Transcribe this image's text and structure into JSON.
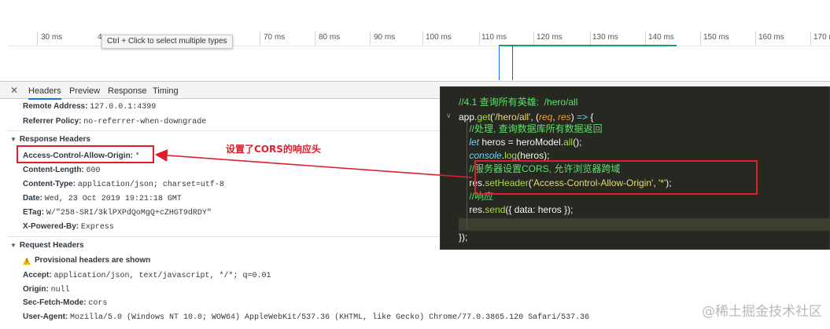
{
  "timeline": {
    "ticks": [
      "30 ms",
      "4",
      "70 ms",
      "80 ms",
      "90 ms",
      "100 ms",
      "110 ms",
      "120 ms",
      "130 ms",
      "140 ms",
      "150 ms",
      "160 ms",
      "170 m"
    ],
    "tooltip": "Ctrl + Click to select multiple types"
  },
  "tabs": {
    "close": "✕",
    "items": [
      "Headers",
      "Preview",
      "Response",
      "Timing"
    ],
    "active": "Headers"
  },
  "general": {
    "remote_address_key": "Remote Address:",
    "remote_address_val": "127.0.0.1:4399",
    "referrer_key": "Referrer Policy:",
    "referrer_val": "no-referrer-when-downgrade"
  },
  "response_headers": {
    "title": "Response Headers",
    "items": [
      {
        "k": "Access-Control-Allow-Origin:",
        "v": "*"
      },
      {
        "k": "Content-Length:",
        "v": "600"
      },
      {
        "k": "Content-Type:",
        "v": "application/json; charset=utf-8"
      },
      {
        "k": "Date:",
        "v": "Wed, 23 Oct 2019 19:21:18 GMT"
      },
      {
        "k": "ETag:",
        "v": "W/\"258-SRI/3klPXPdQoMgQ+cZHGT9dRDY\""
      },
      {
        "k": "X-Powered-By:",
        "v": "Express"
      }
    ]
  },
  "request_headers": {
    "title": "Request Headers",
    "warning": "Provisional headers are shown",
    "items": [
      {
        "k": "Accept:",
        "v": "application/json, text/javascript, */*; q=0.01"
      },
      {
        "k": "Origin:",
        "v": "null"
      },
      {
        "k": "Sec-Fetch-Mode:",
        "v": "cors"
      },
      {
        "k": "User-Agent:",
        "v": "Mozilla/5.0 (Windows NT 10.0; WOW64) AppleWebKit/537.36 (KHTML, like Gecko) Chrome/77.0.3865.120 Safari/537.36"
      }
    ]
  },
  "annotation": "设置了CORS的响应头",
  "code_lines": [
    [
      {
        "t": "//4.1 查询所有英雄:  /hero/all",
        "c": "#5ee06a"
      }
    ],
    [
      {
        "t": "app.",
        "c": "#f8f8f2"
      },
      {
        "t": "get",
        "c": "#a6e22e"
      },
      {
        "t": "(",
        "c": "#f8f8f2"
      },
      {
        "t": "'/hero/all'",
        "c": "#e6db74"
      },
      {
        "t": ", (",
        "c": "#f8f8f2"
      },
      {
        "t": "req",
        "c": "#fd971f"
      },
      {
        "t": ", ",
        "c": "#f8f8f2"
      },
      {
        "t": "res",
        "c": "#fd971f"
      },
      {
        "t": ") ",
        "c": "#f8f8f2"
      },
      {
        "t": "=>",
        "c": "#66d9ef"
      },
      {
        "t": " {",
        "c": "#f8f8f2"
      }
    ],
    [
      {
        "t": "    //处理, 查询数据库所有数据返回",
        "c": "#5ee06a"
      }
    ],
    [
      {
        "t": "    ",
        "c": "#f8f8f2"
      },
      {
        "t": "let",
        "c": "#66d9ef"
      },
      {
        "t": " heros = heroModel.",
        "c": "#f8f8f2"
      },
      {
        "t": "all",
        "c": "#a6e22e"
      },
      {
        "t": "();",
        "c": "#f8f8f2"
      }
    ],
    [
      {
        "t": "    ",
        "c": "#f8f8f2"
      },
      {
        "t": "console",
        "c": "#66d9ef"
      },
      {
        "t": ".",
        "c": "#f8f8f2"
      },
      {
        "t": "log",
        "c": "#a6e22e"
      },
      {
        "t": "(heros);",
        "c": "#f8f8f2"
      }
    ],
    [
      {
        "t": "    //服务器设置CORS, 允许浏览器跨域",
        "c": "#5ee06a"
      }
    ],
    [
      {
        "t": "    res.",
        "c": "#f8f8f2"
      },
      {
        "t": "setHeader",
        "c": "#a6e22e"
      },
      {
        "t": "(",
        "c": "#f8f8f2"
      },
      {
        "t": "'Access-Control-Allow-Origin'",
        "c": "#e6db74"
      },
      {
        "t": ", ",
        "c": "#f8f8f2"
      },
      {
        "t": "'*'",
        "c": "#e6db74"
      },
      {
        "t": ");",
        "c": "#f8f8f2"
      }
    ],
    [
      {
        "t": "    //响应",
        "c": "#5ee06a"
      }
    ],
    [
      {
        "t": "    res.",
        "c": "#f8f8f2"
      },
      {
        "t": "send",
        "c": "#a6e22e"
      },
      {
        "t": "({ data: heros });",
        "c": "#f8f8f2"
      }
    ],
    [
      {
        "t": "",
        "c": "#f8f8f2"
      }
    ],
    [
      {
        "t": "});",
        "c": "#f8f8f2"
      }
    ]
  ],
  "watermark": "@稀土掘金技术社区",
  "colors": {
    "annotation_red": "#e11d2a",
    "code_bg": "#272822",
    "timeline_green": "#16a05d",
    "accent_blue": "#1a73e8"
  }
}
